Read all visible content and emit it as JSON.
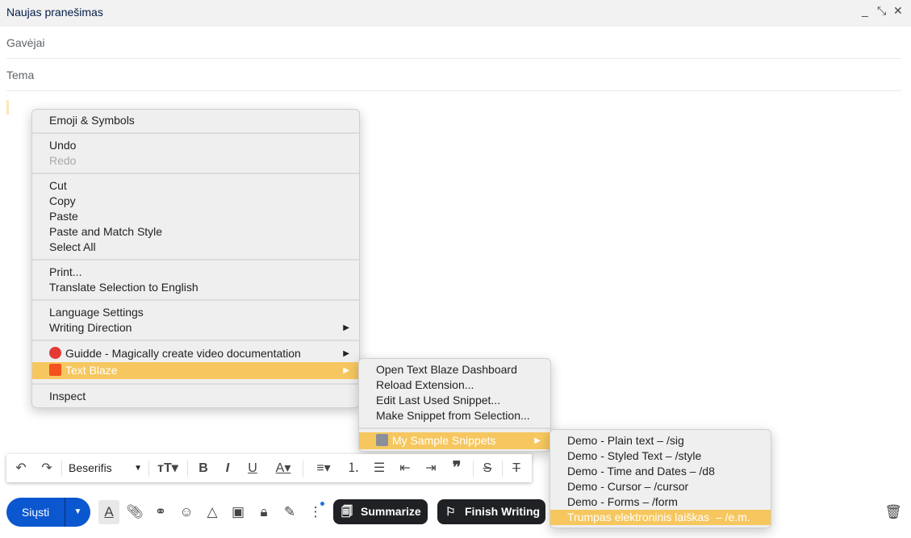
{
  "window": {
    "title": "Naujas pranešimas",
    "minimize": "_",
    "expand": "⤡",
    "close": "✕"
  },
  "fields": {
    "to": "Gavėjai",
    "subject": "Tema"
  },
  "context_menu": {
    "emoji": "Emoji & Symbols",
    "undo": "Undo",
    "redo": "Redo",
    "cut": "Cut",
    "copy": "Copy",
    "paste": "Paste",
    "paste_match": "Paste and Match Style",
    "select_all": "Select All",
    "print": "Print...",
    "translate": "Translate Selection to English",
    "language": "Language Settings",
    "writing_direction": "Writing Direction",
    "guidde": "Guidde - Magically create video documentation",
    "text_blaze": "Text Blaze",
    "inspect": "Inspect"
  },
  "text_blaze_menu": {
    "dashboard": "Open Text Blaze Dashboard",
    "reload": "Reload Extension...",
    "edit_last": "Edit Last Used Snippet...",
    "make_snippet": "Make Snippet from Selection...",
    "folder": "My Sample Snippets"
  },
  "snippets": [
    "Demo - Plain text – /sig",
    "Demo - Styled Text – /style",
    "Demo - Time and Dates – /d8",
    "Demo - Cursor – /cursor",
    "Demo - Forms – /form",
    "Trumpas elektroninis laiškas  – /e.m."
  ],
  "format_toolbar": {
    "font": "Beserifis"
  },
  "bottom": {
    "send": "Siųsti",
    "summarize": "Summarize",
    "finish": "Finish Writing"
  },
  "colors": {
    "highlight": "#f6c75f",
    "send": "#0b57d0",
    "dark_button": "#202124"
  }
}
